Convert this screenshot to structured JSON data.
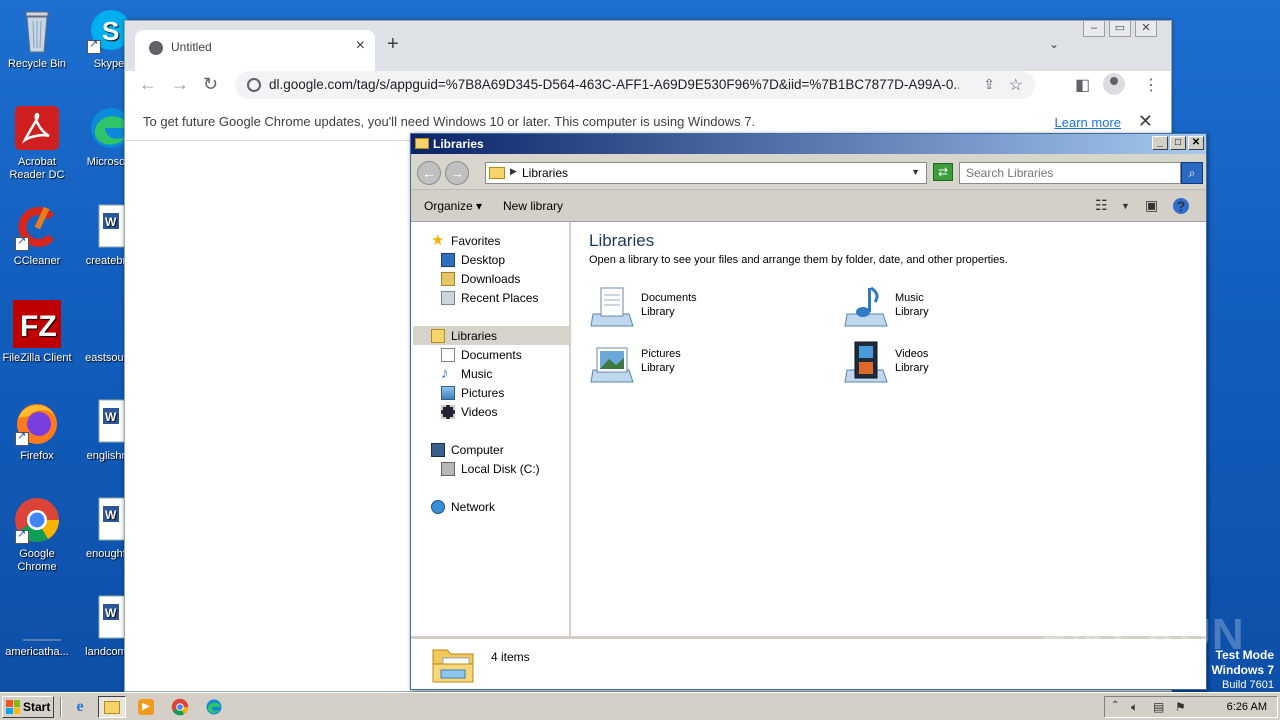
{
  "desktop": {
    "icons": [
      {
        "label": "Recycle Bin",
        "icon": "recycle-bin-icon"
      },
      {
        "label": "Skype",
        "icon": "skype-icon"
      },
      {
        "label": "Acrobat Reader DC",
        "icon": "acrobat-icon"
      },
      {
        "label": "Microsoft",
        "icon": "edge-icon"
      },
      {
        "label": "CCleaner",
        "icon": "ccleaner-icon"
      },
      {
        "label": "createbro",
        "icon": "word-doc-icon"
      },
      {
        "label": "FileZilla Client",
        "icon": "filezilla-icon"
      },
      {
        "label": "eastsouth",
        "icon": "blank-icon"
      },
      {
        "label": "Firefox",
        "icon": "firefox-icon"
      },
      {
        "label": "englishre",
        "icon": "word-doc-icon"
      },
      {
        "label": "Google Chrome",
        "icon": "chrome-icon"
      },
      {
        "label": "enoughfo",
        "icon": "word-doc-icon"
      },
      {
        "label": "americatha...",
        "icon": "blank-icon"
      },
      {
        "label": "landcomp",
        "icon": "word-doc-icon"
      }
    ]
  },
  "chrome": {
    "tab_title": "Untitled",
    "url": "dl.google.com/tag/s/appguid=%7B8A69D345-D564-463C-AFF1-A69D9E530F96%7D&iid=%7B1BC7877D-A99A-0...",
    "infobar_message": "To get future Google Chrome updates, you'll need Windows 10 or later. This computer is using Windows 7.",
    "learn_more": "Learn more"
  },
  "explorer": {
    "title": "Libraries",
    "address": "Libraries",
    "search_placeholder": "Search Libraries",
    "organize": "Organize",
    "new_library": "New library",
    "nav": {
      "favorites": "Favorites",
      "desktop": "Desktop",
      "downloads": "Downloads",
      "recent_places": "Recent Places",
      "libraries": "Libraries",
      "documents": "Documents",
      "music": "Music",
      "pictures": "Pictures",
      "videos": "Videos",
      "computer": "Computer",
      "local_disk": "Local Disk (C:)",
      "network": "Network"
    },
    "heading": "Libraries",
    "subheading": "Open a library to see your files and arrange them by folder, date, and other properties.",
    "libraries": [
      {
        "name": "Documents",
        "type": "Library"
      },
      {
        "name": "Music",
        "type": "Library"
      },
      {
        "name": "Pictures",
        "type": "Library"
      },
      {
        "name": "Videos",
        "type": "Library"
      }
    ],
    "status": "4 items"
  },
  "watermark": "ANY RUN",
  "test_mode": {
    "line1": "Test Mode",
    "line2": "Windows 7",
    "line3": "Build 7601"
  },
  "taskbar": {
    "start": "Start",
    "clock": "6:26 AM"
  }
}
